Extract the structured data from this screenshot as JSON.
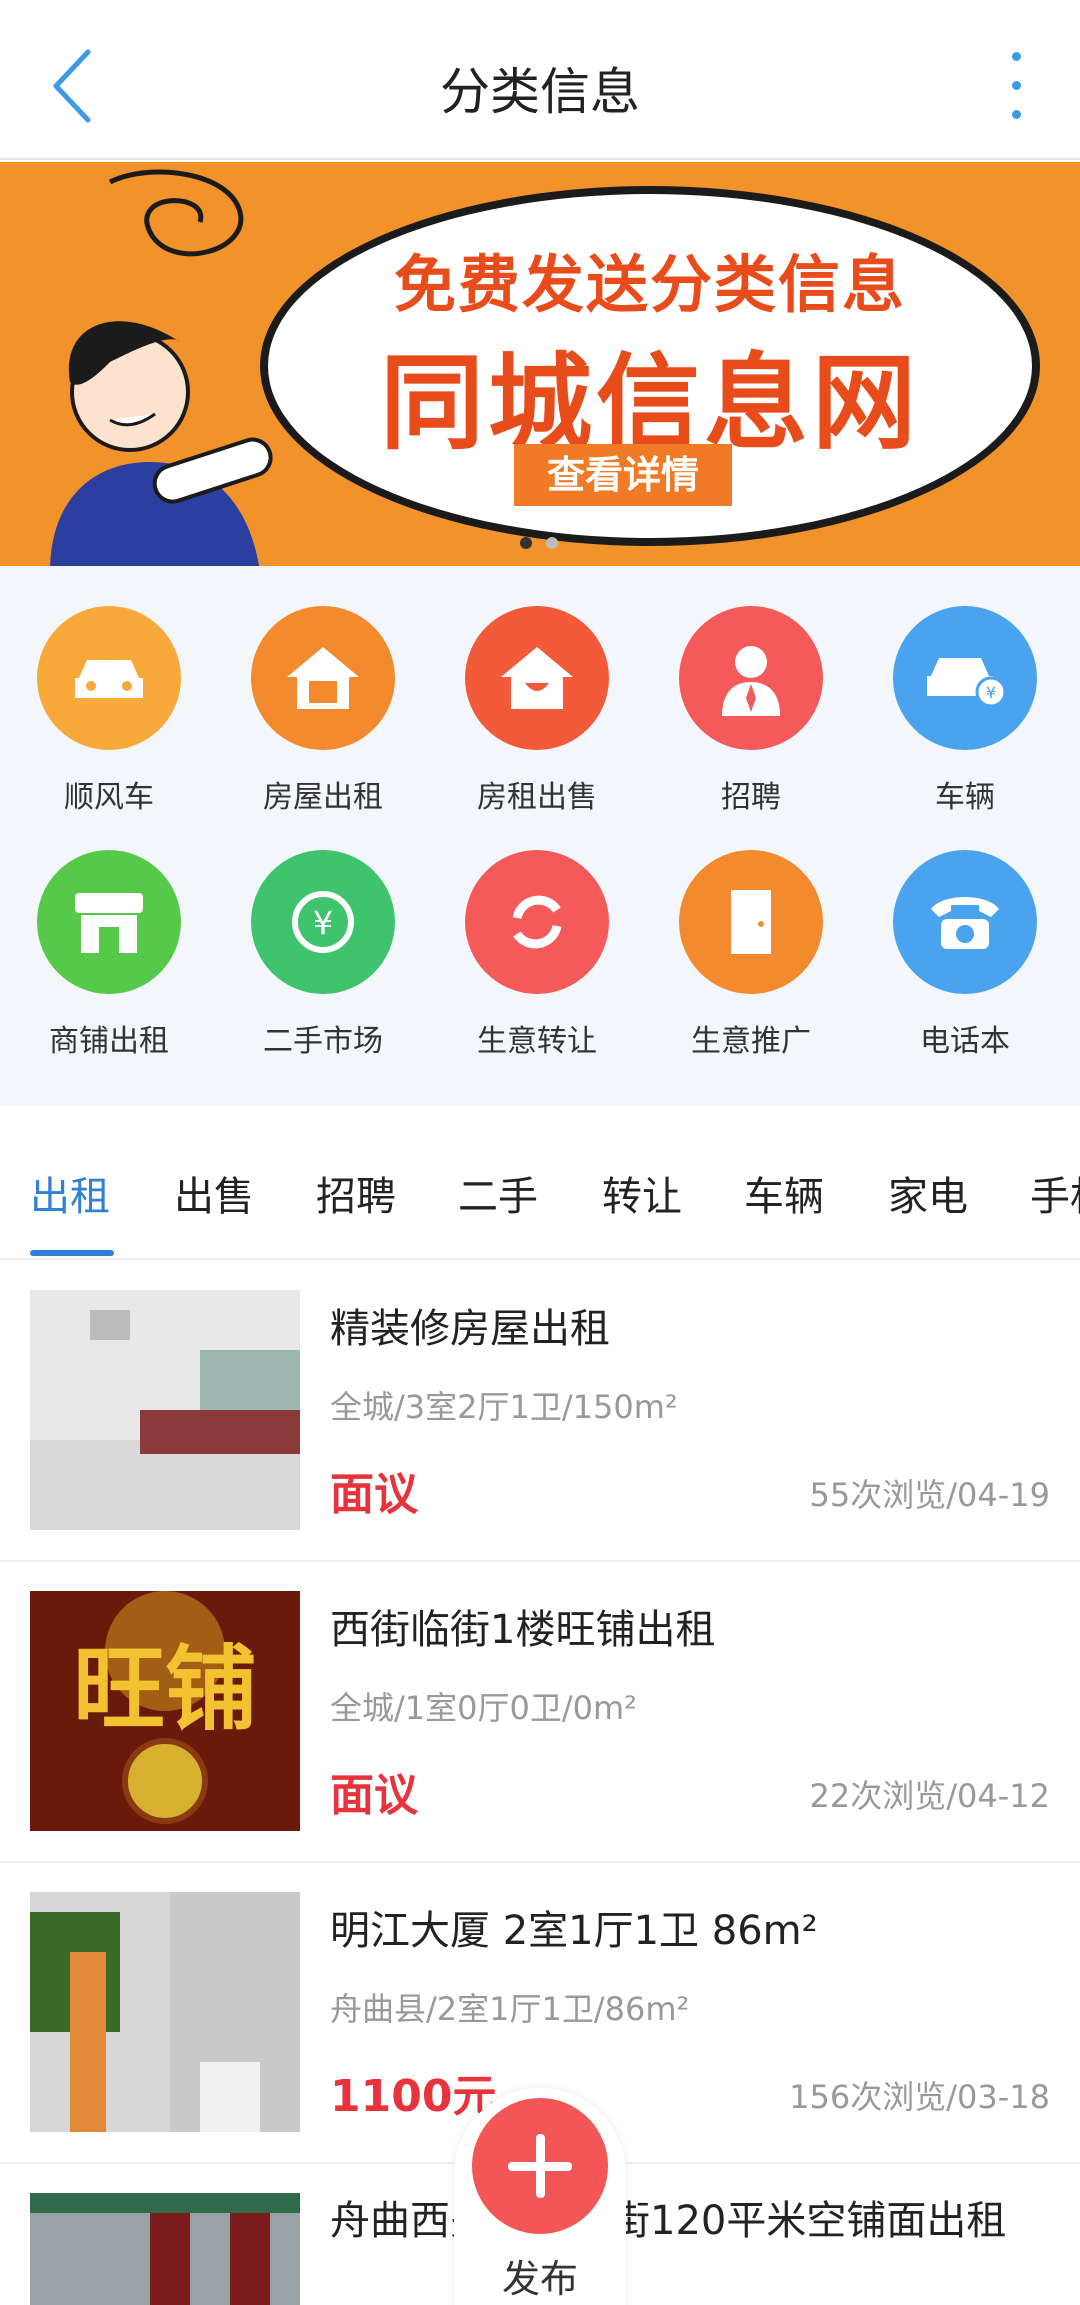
{
  "header": {
    "title": "分类信息"
  },
  "banner": {
    "line1": "免费发送分类信息",
    "line2": "同城信息网",
    "button": "查看详情"
  },
  "categories": [
    {
      "label": "顺风车",
      "icon": "car-icon",
      "color": "#f9a93a"
    },
    {
      "label": "房屋出租",
      "icon": "house-rent-icon",
      "color": "#f38a2e"
    },
    {
      "label": "房租出售",
      "icon": "house-icon",
      "color": "#f25a3a"
    },
    {
      "label": "招聘",
      "icon": "recruit-person-icon",
      "color": "#f45a5a"
    },
    {
      "label": "车辆",
      "icon": "car-price-icon",
      "color": "#4aa3ef"
    },
    {
      "label": "商铺出租",
      "icon": "shop-icon",
      "color": "#57c94a"
    },
    {
      "label": "二手市场",
      "icon": "yen-cycle-icon",
      "color": "#3fc46d"
    },
    {
      "label": "生意转让",
      "icon": "transfer-icon",
      "color": "#f55a5a"
    },
    {
      "label": "生意推广",
      "icon": "door-icon",
      "color": "#f38a2e"
    },
    {
      "label": "电话本",
      "icon": "phone-icon",
      "color": "#4aa3ef"
    }
  ],
  "tabs": [
    "出租",
    "出售",
    "招聘",
    "二手",
    "转让",
    "车辆",
    "家电",
    "手机"
  ],
  "listings": [
    {
      "title": "精装修房屋出租",
      "meta": "全城/3室2厅1卫/150m²",
      "price": "面议",
      "stats": "55次浏览/04-19"
    },
    {
      "title": "西街临街1楼旺铺出租",
      "meta": "全城/1室0厅0卫/0m²",
      "price": "面议",
      "stats": "22次浏览/04-12"
    },
    {
      "title": "明江大厦 2室1厅1卫 86m²",
      "meta": "舟曲县/2室1厅1卫/86m²",
      "price": "1100元",
      "stats": "156次浏览/03-18"
    },
    {
      "title": "舟曲西关二楼临街120平米空铺面出租"
    }
  ],
  "fab": {
    "label": "发布"
  }
}
